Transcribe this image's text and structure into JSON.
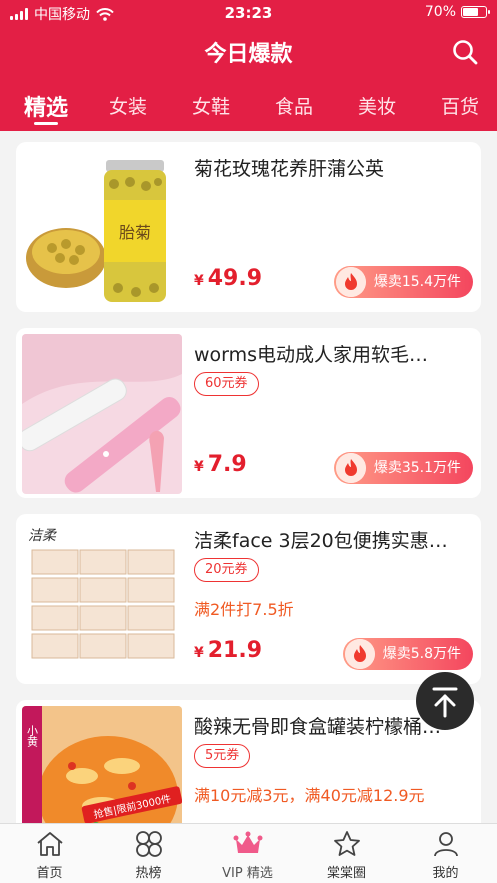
{
  "status_bar": {
    "carrier": "中国移动",
    "time": "23:23",
    "battery": "70%",
    "battery_level": 0.7
  },
  "header": {
    "title": "今日爆款",
    "search_icon": "search-icon"
  },
  "tabs": [
    {
      "label": "精选",
      "active": true
    },
    {
      "label": "女装"
    },
    {
      "label": "女鞋"
    },
    {
      "label": "食品"
    },
    {
      "label": "美妆"
    },
    {
      "label": "百货"
    }
  ],
  "products": [
    {
      "name": "菊花玫瑰花养肝蒲公英",
      "coupon": "",
      "promo": "",
      "currency": "¥",
      "price": "49.9",
      "hot": "爆卖15.4万件",
      "jar_label": "胎菊"
    },
    {
      "name": "worms电动成人家用软毛…",
      "coupon": "60元券",
      "promo": "",
      "currency": "¥",
      "price": "7.9",
      "hot": "爆卖35.1万件"
    },
    {
      "name": "洁柔face 3层20包便携实惠…",
      "coupon": "20元券",
      "promo": "满2件打7.5折",
      "currency": "¥",
      "price": "21.9",
      "hot": "爆卖5.8万件",
      "brand": "洁柔"
    },
    {
      "name": "酸辣无骨即食盒罐装柠檬桶…",
      "coupon": "5元券",
      "promo": "满10元减3元，满40元减12.9元",
      "currency": "¥",
      "price": "",
      "hot": "",
      "ribbon": "抢售|限前3000件",
      "tag": "小黄"
    }
  ],
  "bottom_nav": [
    {
      "label": "首页",
      "icon": "home-icon"
    },
    {
      "label": "热榜",
      "icon": "grid-icon"
    },
    {
      "label": "VIP 精选",
      "icon": "crown-icon",
      "active": true
    },
    {
      "label": "棠棠圈",
      "icon": "star-icon"
    },
    {
      "label": "我的",
      "icon": "user-icon"
    }
  ],
  "colors": {
    "brand": "#e31f45",
    "price": "#e31f2d",
    "promo": "#f05a23"
  }
}
